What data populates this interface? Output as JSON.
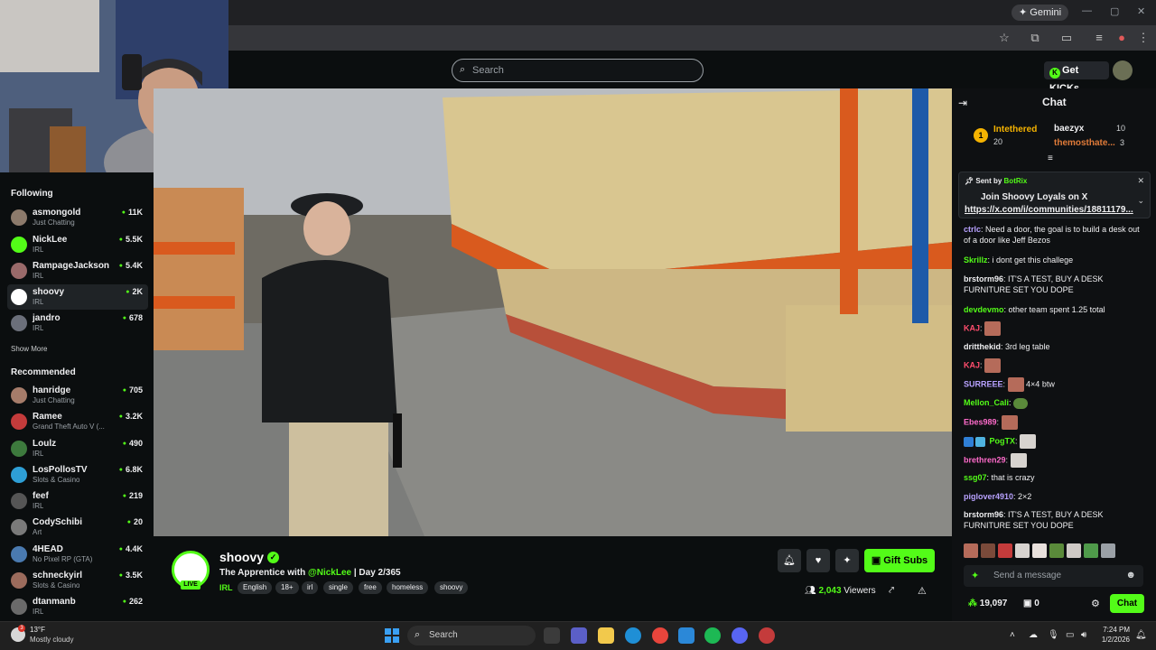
{
  "browser": {
    "gemini_label": "Gemini"
  },
  "topnav": {
    "search_placeholder": "Search",
    "get_kicks_label": "Get KICKs"
  },
  "sidebar": {
    "following_heading": "Following",
    "following": [
      {
        "name": "asmongold",
        "category": "Just Chatting",
        "viewers": "11K",
        "avatar_color": "#8c7a6b"
      },
      {
        "name": "NickLee",
        "category": "IRL",
        "viewers": "5.5K",
        "avatar_color": "#53fc18"
      },
      {
        "name": "RampageJackson",
        "category": "IRL",
        "viewers": "5.4K",
        "avatar_color": "#9a6a6a"
      },
      {
        "name": "shoovy",
        "category": "IRL",
        "viewers": "2K",
        "avatar_color": "#ffffff"
      },
      {
        "name": "jandro",
        "category": "IRL",
        "viewers": "678",
        "avatar_color": "#6b6f7a"
      }
    ],
    "show_more_label": "Show More",
    "recommended_heading": "Recommended",
    "recommended": [
      {
        "name": "hanridge",
        "category": "Just Chatting",
        "viewers": "705",
        "avatar_color": "#a67c6a"
      },
      {
        "name": "Ramee",
        "category": "Grand Theft Auto V (...",
        "viewers": "3.2K",
        "avatar_color": "#c43b3b"
      },
      {
        "name": "Loulz",
        "category": "IRL",
        "viewers": "490",
        "avatar_color": "#3d7a3d"
      },
      {
        "name": "LosPollosTV",
        "category": "Slots & Casino",
        "viewers": "6.8K",
        "avatar_color": "#2e9fd6"
      },
      {
        "name": "feef",
        "category": "IRL",
        "viewers": "219",
        "avatar_color": "#555555"
      },
      {
        "name": "CodySchibi",
        "category": "Art",
        "viewers": "20",
        "avatar_color": "#7a7a7a"
      },
      {
        "name": "4HEAD",
        "category": "No Pixel RP (GTA)",
        "viewers": "4.4K",
        "avatar_color": "#4a7ab0"
      },
      {
        "name": "schneckyirl",
        "category": "Slots & Casino",
        "viewers": "3.5K",
        "avatar_color": "#9b6b5c"
      },
      {
        "name": "dtanmanb",
        "category": "IRL",
        "viewers": "262",
        "avatar_color": "#6a6a6a"
      }
    ]
  },
  "stream": {
    "streamer": "shoovy",
    "live_label": "LIVE",
    "title_prefix": "The Apprentice with ",
    "title_mention": "@NickLee",
    "title_suffix": " | Day 2/365",
    "category": "IRL",
    "tags": [
      "English",
      "18+",
      "irl",
      "single",
      "free",
      "homeless",
      "shoovy"
    ],
    "gift_subs_label": "Gift Subs",
    "viewer_count": "2,043",
    "viewers_label": "Viewers"
  },
  "chat": {
    "title": "Chat",
    "leaderboard": {
      "rank1": "1",
      "first_name": "Intethered",
      "first_value": "20",
      "second_name": "baezyx",
      "second_value": "10",
      "third_name": "themosthate...",
      "third_value": "3"
    },
    "pinned": {
      "sent_by": "Sent by",
      "bot": "BotRix",
      "message": "Join Shoovy Loyals on X",
      "link": "https://x.com/i/communities/18811179..."
    },
    "messages": [
      {
        "user": "ctrlc",
        "color": "#b8a2ff",
        "text": "Need a door, the goal is to build a desk out of a door like Jeff Bezos"
      },
      {
        "user": "Skrillz",
        "color": "#53fc18",
        "text": "i dont get this challege"
      },
      {
        "user": "brstorm96",
        "color": "#efeff1",
        "text": "IT'S A TEST, BUY A DESK FURNITURE SET YOU DOPE"
      },
      {
        "user": "devdevmo",
        "color": "#53fc18",
        "text": "other team spent 1.25 total"
      },
      {
        "user": "KAJ",
        "color": "#ff4d6d",
        "text": ""
      },
      {
        "user": "dritthekid",
        "color": "#efeff1",
        "text": "3rd leg table"
      },
      {
        "user": "KAJ",
        "color": "#ff4d6d",
        "text": ""
      },
      {
        "user": "SURREEE",
        "color": "#b8a2ff",
        "text": "4×4 btw"
      },
      {
        "user": "Mellon_Cali",
        "color": "#53fc18",
        "text": ""
      },
      {
        "user": "Ebes989",
        "color": "#ff6bcb",
        "text": ""
      },
      {
        "user": "PogTX",
        "color": "#53fc18",
        "text": ""
      },
      {
        "user": "brethren29",
        "color": "#ff6bcb",
        "text": ""
      },
      {
        "user": "ssg07",
        "color": "#53fc18",
        "text": "that is crazy"
      },
      {
        "user": "piglover4910",
        "color": "#b8a2ff",
        "text": "2×2"
      },
      {
        "user": "brstorm96",
        "color": "#efeff1",
        "text": "IT'S A TEST, BUY A DESK FURNITURE SET YOU DOPE"
      }
    ],
    "send_placeholder": "Send a message",
    "points": "19,097",
    "drops": "0",
    "chat_button": "Chat"
  },
  "taskbar": {
    "temp": "13°F",
    "weather": "Mostly cloudy",
    "notif_count": "3",
    "search_label": "Search",
    "time": "7:24 PM",
    "date": "1/2/2026"
  }
}
